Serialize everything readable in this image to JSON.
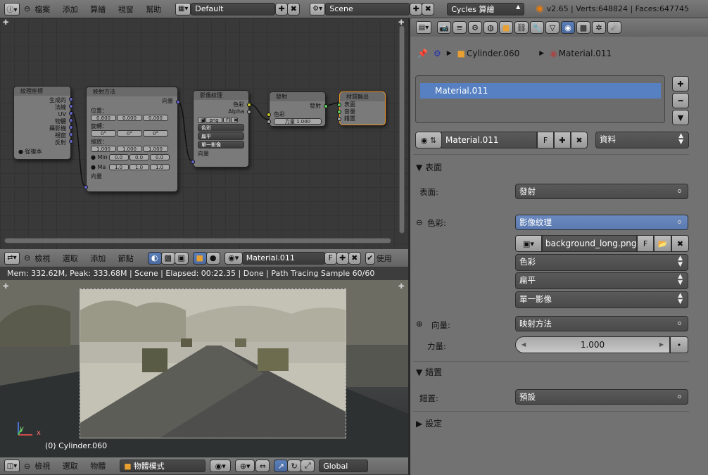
{
  "top_header": {
    "menus": [
      "檔案",
      "添加",
      "算繪",
      "視窗",
      "幫助"
    ],
    "layout": "Default",
    "scene": "Scene",
    "engine": "Cycles 算繪",
    "stats": "v2.65 | Verts:648824 | Faces:647745"
  },
  "nodes": {
    "texcoord": {
      "title": "紋理座標",
      "outputs": [
        "生成的",
        "法線",
        "UV",
        "物體",
        "攝影機",
        "視窗",
        "反射"
      ],
      "checkbox": "從複本"
    },
    "mapping": {
      "title": "映射方法",
      "out": "向量",
      "loc_label": "位置：",
      "loc": [
        "0.600",
        "0.000",
        "0.000"
      ],
      "rot_label": "旋轉：",
      "rot": [
        "0°",
        "0°",
        "0°"
      ],
      "scale_label": "縮放：",
      "scale": [
        "1.000",
        "1.000",
        "1.000"
      ],
      "min_label": "Min",
      "min": [
        "0.0",
        "0.0",
        "0.0"
      ],
      "max_label": "Ma",
      "max": [
        "1.0",
        "1.0",
        "1.0"
      ],
      "in": "向量"
    },
    "imgtex": {
      "title": "影像紋理",
      "out_color": "色彩",
      "out_alpha": "Alpha",
      "img": "png",
      "img_f": "F",
      "color": "色彩",
      "proj": "扁平",
      "src": "單一影像",
      "in": "向量"
    },
    "emission": {
      "title": "發射",
      "out": "發射",
      "in_color": "色彩",
      "strength_label": "力量",
      "strength": "1.000"
    },
    "output": {
      "title": "材質輸出",
      "in1": "表面",
      "in2": "音量",
      "in3": "錯置"
    }
  },
  "node_header": {
    "menus": [
      "檢視",
      "選取",
      "添加",
      "節點"
    ],
    "material": "Material.011",
    "f": "F",
    "use": "使用"
  },
  "render_status": "Mem: 332.62M, Peak: 333.68M | Scene | Elapsed: 00:22.35 | Done | Path Tracing Sample 60/60",
  "viewport": {
    "object_label": "(0) Cylinder.060",
    "axis_x": "x",
    "axis_y": "y"
  },
  "view_header": {
    "menus": [
      "檢視",
      "選取",
      "物體"
    ],
    "mode": "物體模式",
    "orientation": "Global"
  },
  "properties": {
    "breadcrumb": [
      "Cylinder.060",
      "Material.011"
    ],
    "slot": "Material.011",
    "material_name": "Material.011",
    "f": "F",
    "data_link": "資料",
    "surface_section": "表面",
    "surface_label": "表面:",
    "surface_value": "發射",
    "color_label": "色彩:",
    "color_value": "影像紋理",
    "image_file": "background_long.png",
    "image_f": "F",
    "tex_color": "色彩",
    "tex_proj": "扁平",
    "tex_source": "單一影像",
    "vector_label": "向量:",
    "vector_value": "映射方法",
    "strength_label": "力量:",
    "strength_value": "1.000",
    "disp_section": "錯置",
    "disp_label": "錯置:",
    "disp_value": "預設",
    "settings_section": "設定"
  }
}
